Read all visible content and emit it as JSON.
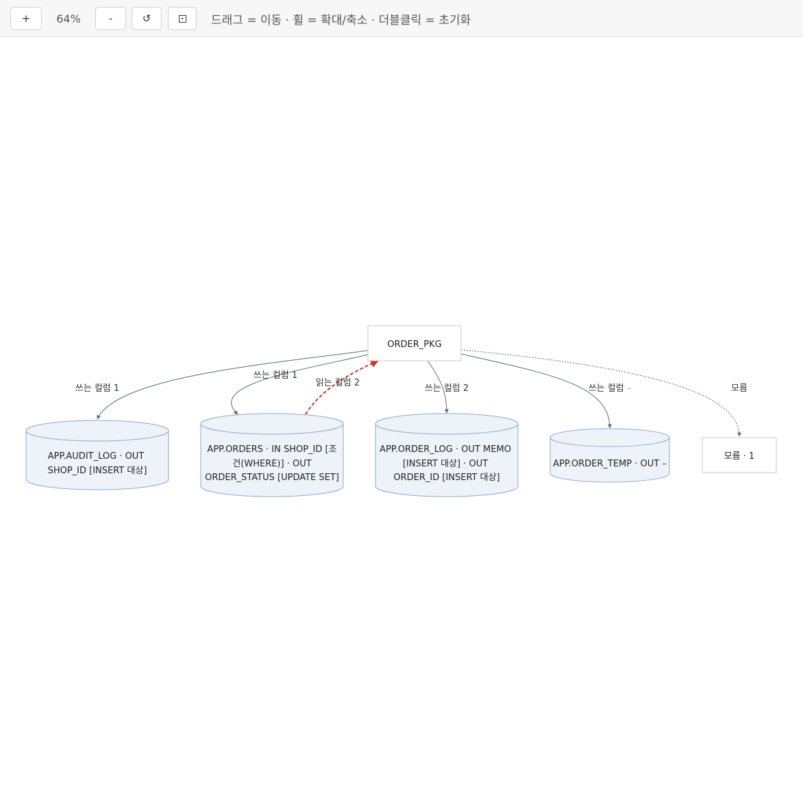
{
  "toolbar": {
    "zoom_in_label": "+",
    "zoom_level": "64%",
    "zoom_out_label": "-",
    "reset_label": "↺",
    "hint": "드래그 = 이동 · 휠 = 확대/축소 · 더블클릭 = 초기화"
  },
  "diagram": {
    "root": {
      "label": "ORDER_PKG"
    },
    "nodes": {
      "audit_log": {
        "line1": "APP.AUDIT_LOG · OUT",
        "line2": "SHOP_ID [INSERT 대상]"
      },
      "orders": {
        "line1": "APP.ORDERS · IN   SHOP_ID [조",
        "line2": "건(WHERE)] · OUT",
        "line3": "ORDER_STATUS [UPDATE SET]"
      },
      "order_log": {
        "line1": "APP.ORDER_LOG · OUT MEMO",
        "line2": "[INSERT 대상] · OUT",
        "line3": "ORDER_ID [INSERT 대상]"
      },
      "order_temp": {
        "line1": "APP.ORDER_TEMP · OUT –"
      },
      "unknown": {
        "label": "모름 · 1"
      }
    },
    "edges": {
      "to_audit_log": "쓰는 컬럼 1",
      "to_orders": "쓰는 컬럼 1",
      "from_orders": "읽는 컬럼 2",
      "to_order_log": "쓰는 컬럼 2",
      "to_order_temp": "쓰는 컬럼",
      "to_order_temp_suffix": "–",
      "to_unknown": "모름"
    },
    "colors": {
      "table_fill": "#eef3fa",
      "table_stroke": "#8aa9cc",
      "edge": "#5f6770",
      "read_edge": "#c0392b",
      "box_stroke": "#c8c8c8"
    }
  }
}
